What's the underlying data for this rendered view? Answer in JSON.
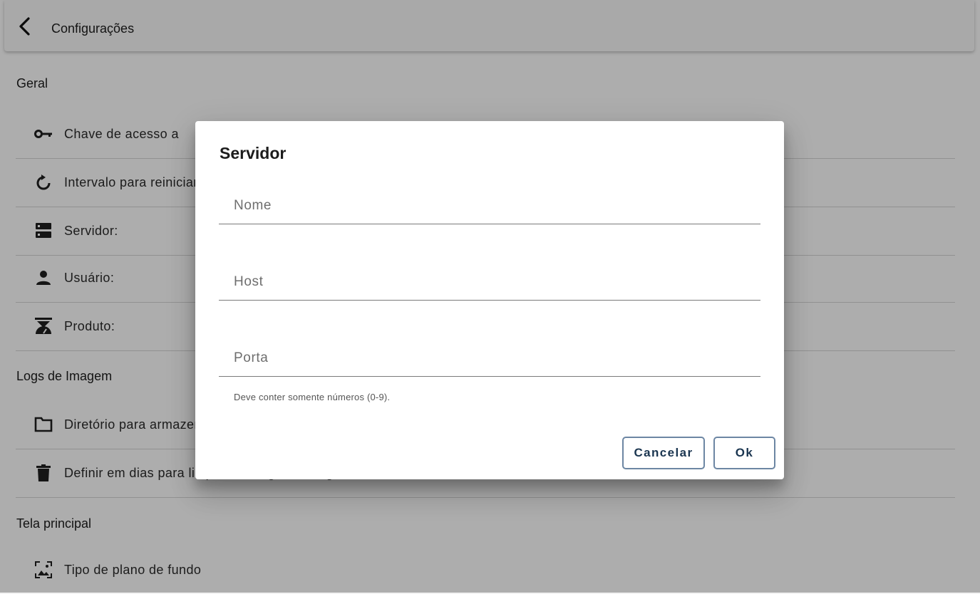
{
  "appbar": {
    "title": "Configurações"
  },
  "sections": {
    "geral": "Geral",
    "logs": "Logs de Imagem",
    "tela": "Tela principal"
  },
  "items": {
    "chave": "Chave de acesso a",
    "intervalo": "Intervalo para reiniciar",
    "servidor": "Servidor:",
    "usuario": "Usuário:",
    "produto": "Produto:",
    "diretorio": "Diretório para armazenar",
    "definir": "Definir em dias para limpeza de logs de imagem",
    "tipo": "Tipo de plano de fundo"
  },
  "dialog": {
    "title": "Servidor",
    "fields": {
      "nome_placeholder": "Nome",
      "host_placeholder": "Host",
      "porta_placeholder": "Porta",
      "porta_helper": "Deve conter somente números (0-9)."
    },
    "cancel_label": "Cancelar",
    "ok_label": "Ok"
  },
  "colors": {
    "overlay": "#000000",
    "button_border": "#6c86a3",
    "button_text": "#1a3550"
  }
}
